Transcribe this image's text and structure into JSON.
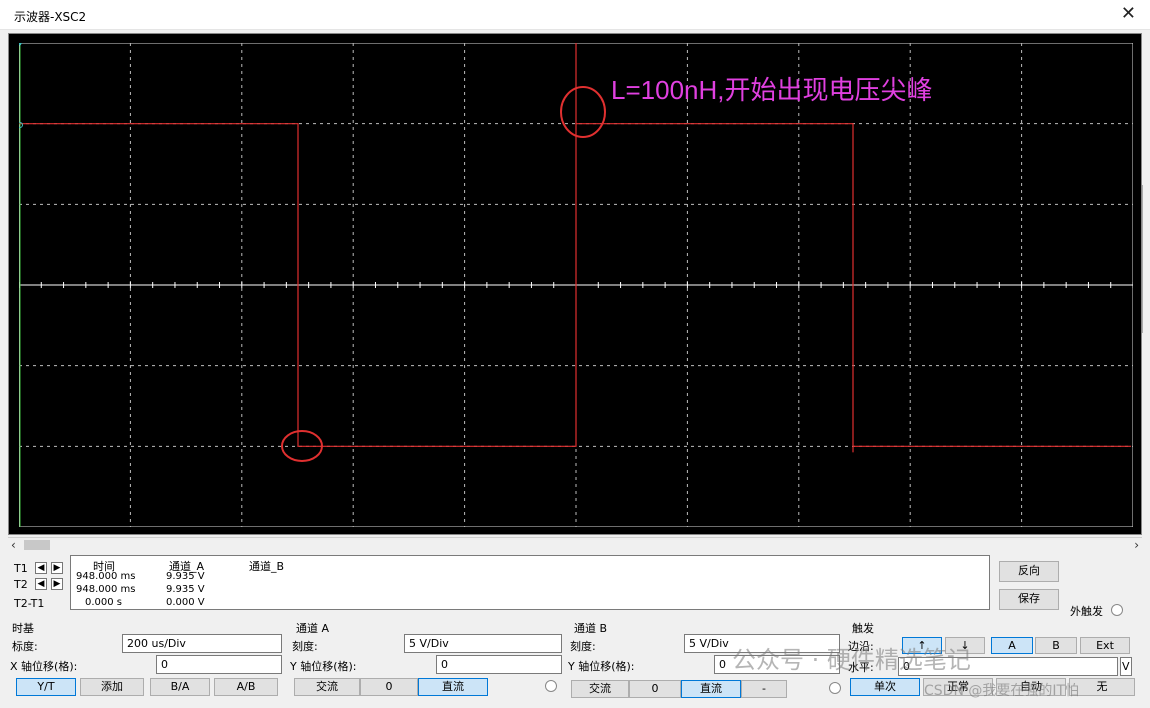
{
  "window": {
    "title": "示波器-XSC2",
    "close_icon": "close-icon"
  },
  "screen": {
    "annotation": "L=100nH,开始出现电压尖峰",
    "colors": {
      "background": "#000000",
      "grid": "#bdbdbd",
      "trace": "#e03030",
      "annotation": "#e040e0",
      "cursor": "#ffffff",
      "cursor1": "#40c040"
    }
  },
  "cursor_panel": {
    "rows": [
      {
        "label": "T1"
      },
      {
        "label": "T2"
      },
      {
        "label": "T2-T1"
      }
    ],
    "headers": {
      "time": "时间",
      "channel_a": "通道_A",
      "channel_b": "通道_B"
    },
    "values": [
      {
        "time": "948.000 ms",
        "a": "9.935 V",
        "b": ""
      },
      {
        "time": "948.000 ms",
        "a": "9.935 V",
        "b": ""
      },
      {
        "time": "0.000 s",
        "a": "0.000 V",
        "b": ""
      }
    ],
    "reverse_label": "反向",
    "save_label": "保存",
    "ext_trigger_label": "外触发"
  },
  "timebase": {
    "title": "时基",
    "scale_label": "标度:",
    "scale_value": "200 us/Div",
    "xpos_label": "X 轴位移(格):",
    "xpos_value": "0",
    "buttons": [
      "Y/T",
      "添加",
      "B/A",
      "A/B"
    ],
    "selected": "Y/T"
  },
  "channel_a": {
    "title": "通道 A",
    "scale_label": "刻度:",
    "scale_value": "5  V/Div",
    "ypos_label": "Y 轴位移(格):",
    "ypos_value": "0",
    "buttons": [
      "交流",
      "0",
      "直流"
    ],
    "selected": "直流"
  },
  "channel_b": {
    "title": "通道 B",
    "scale_label": "刻度:",
    "scale_value": "5  V/Div",
    "ypos_label": "Y 轴位移(格):",
    "ypos_value": "0",
    "buttons": [
      "交流",
      "0",
      "直流",
      "-"
    ],
    "selected": "直流"
  },
  "trigger": {
    "title": "触发",
    "edge_label": "边沿:",
    "edge_buttons": [
      "↑",
      "↓",
      "A",
      "B",
      "Ext"
    ],
    "selected_edge": "A",
    "level_label": "水平:",
    "level_value": "0",
    "level_unit": "V",
    "mode_buttons": [
      "单次",
      "正常",
      "自动",
      "无"
    ],
    "selected_mode": "单次"
  },
  "watermark": {
    "text1": "公众号 · 硬件精选笔记",
    "text2": "CSDN @我要在强的IT怕"
  }
}
